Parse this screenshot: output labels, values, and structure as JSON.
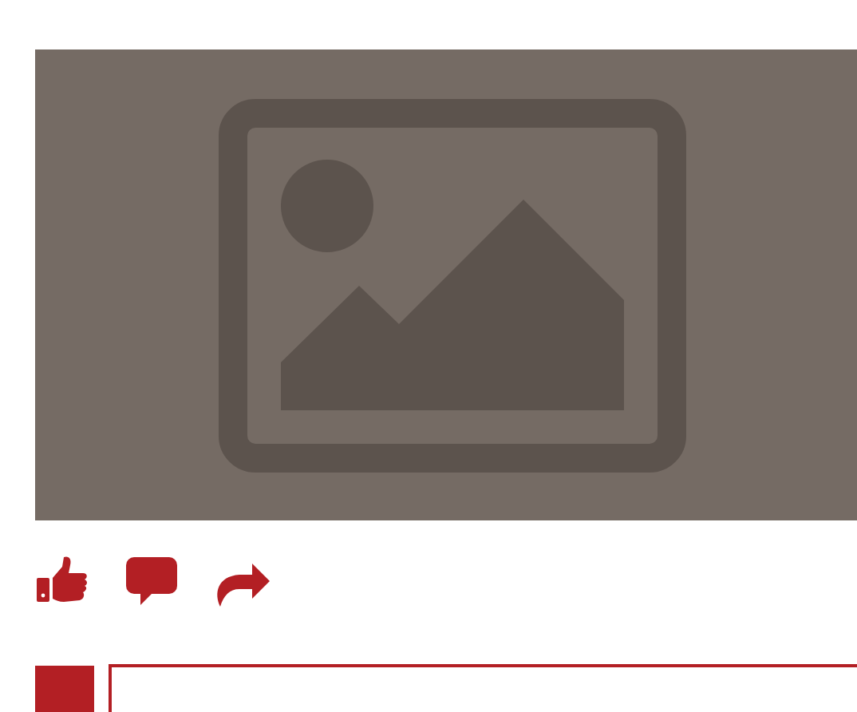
{
  "media": {
    "kind": "placeholder"
  },
  "actions": [
    {
      "kind": "like"
    },
    {
      "kind": "comment"
    },
    {
      "kind": "share"
    }
  ],
  "comment_form": {
    "kind": "field"
  }
}
